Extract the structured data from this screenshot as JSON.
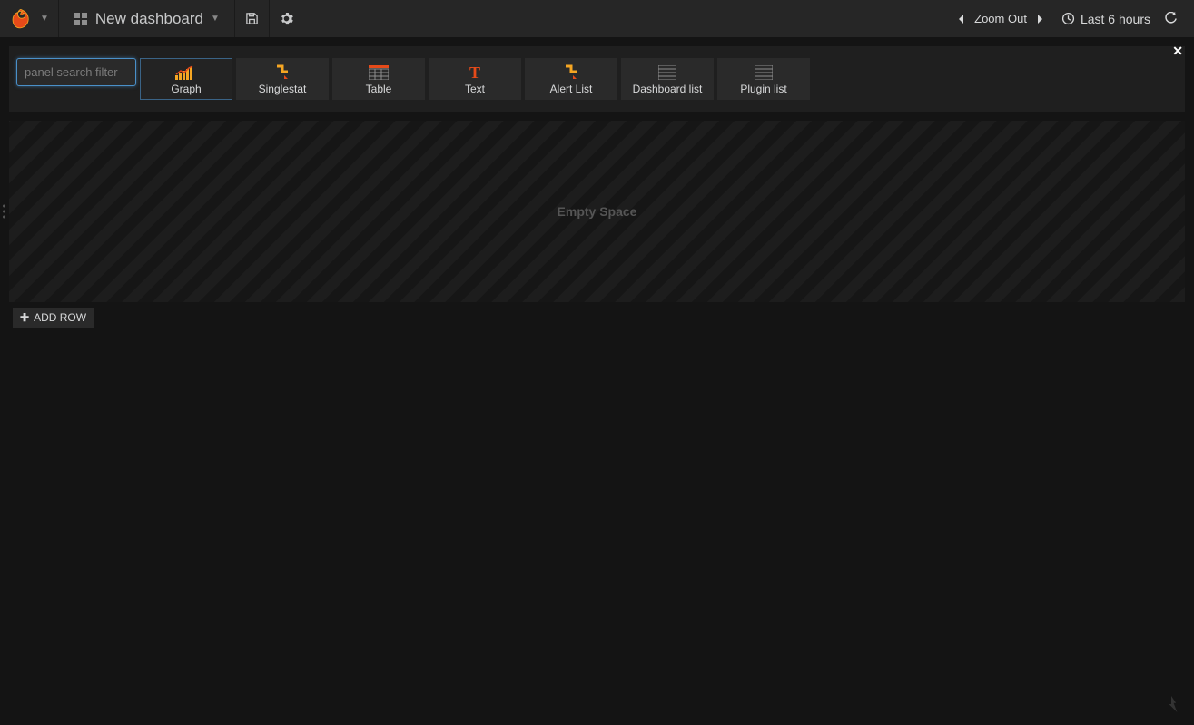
{
  "navbar": {
    "title": "New dashboard",
    "zoom_out": "Zoom Out",
    "time_range": "Last 6 hours"
  },
  "picker": {
    "search_placeholder": "panel search filter",
    "panels": [
      {
        "label": "Graph",
        "icon": "graph",
        "selected": true
      },
      {
        "label": "Singlestat",
        "icon": "singlestat",
        "selected": false
      },
      {
        "label": "Table",
        "icon": "table",
        "selected": false
      },
      {
        "label": "Text",
        "icon": "text",
        "selected": false
      },
      {
        "label": "Alert List",
        "icon": "alert",
        "selected": false
      },
      {
        "label": "Dashboard list",
        "icon": "list",
        "selected": false
      },
      {
        "label": "Plugin list",
        "icon": "list",
        "selected": false
      }
    ]
  },
  "body": {
    "empty_label": "Empty Space",
    "add_row_label": "ADD ROW"
  }
}
